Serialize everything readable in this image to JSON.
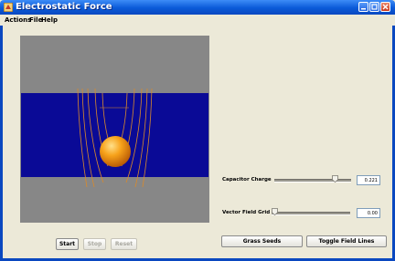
{
  "window": {
    "title": "Electrostatic Force"
  },
  "menu": [
    "Actions",
    "File",
    "Help"
  ],
  "controls": {
    "start": "Start",
    "stop": "Stop",
    "reset": "Reset",
    "capacitor_label": "Capacitor Charge",
    "capacitor_value": "0.221",
    "capacitor_level": 0.82,
    "field_label": "Vector Field Grid",
    "field_value": "0.00",
    "field_level": 0.0,
    "grass_seeds": "Grass Seeds",
    "toggle_field_lines": "Toggle Field Lines"
  },
  "colors": {
    "plate": "#878787",
    "field_region": "#0a0a96",
    "field_line": "#d98a2b",
    "ball": "#f59a10"
  }
}
